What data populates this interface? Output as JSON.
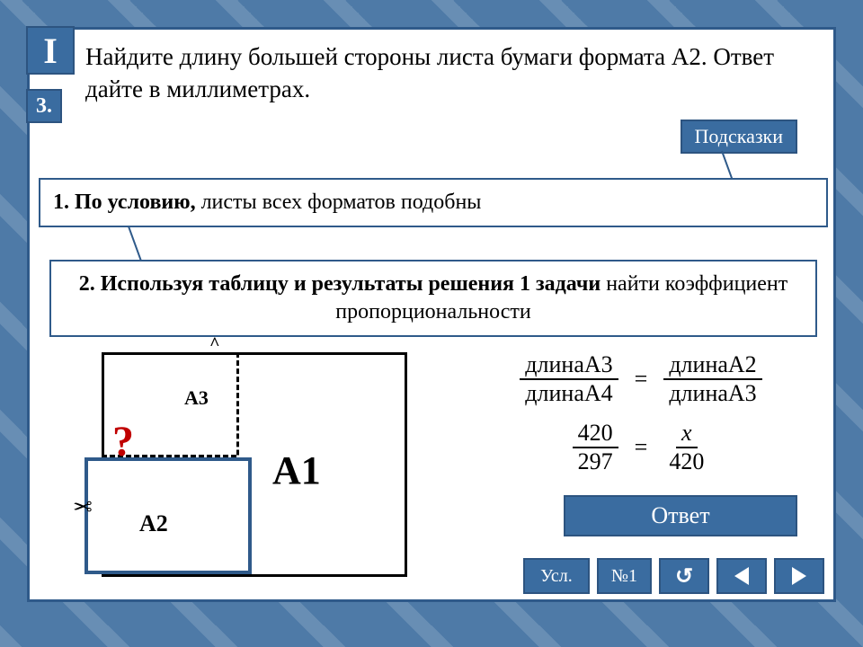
{
  "badges": {
    "part": "I",
    "num": "3."
  },
  "question": "Найдите длину большей стороны листа бумаги формата А2. Ответ дайте в миллиметрах.",
  "hints_btn": "Подсказки",
  "hint1_lead": "1. По условию,",
  "hint1_rest": "  листы всех форматов подобны",
  "hint2_lead": "2. Используя таблицу и результаты решения 1 задачи",
  "hint2_rest": " найти коэффициент пропорциональности",
  "diagram": {
    "a1": "A1",
    "a2": "A2",
    "a3": "A3",
    "qmark": "?",
    "scissors": "✂",
    "chev": "^"
  },
  "eq": {
    "f1n": "длинаА3",
    "f1d": "длинаА4",
    "f2n": "длинаА2",
    "f2d": "длинаА3",
    "g1n": "420",
    "g1d": "297",
    "g2n": "x",
    "g2d": "420",
    "eq": "="
  },
  "answer_btn": "Ответ",
  "nav": {
    "usl": "Усл.",
    "n1": "№1"
  }
}
